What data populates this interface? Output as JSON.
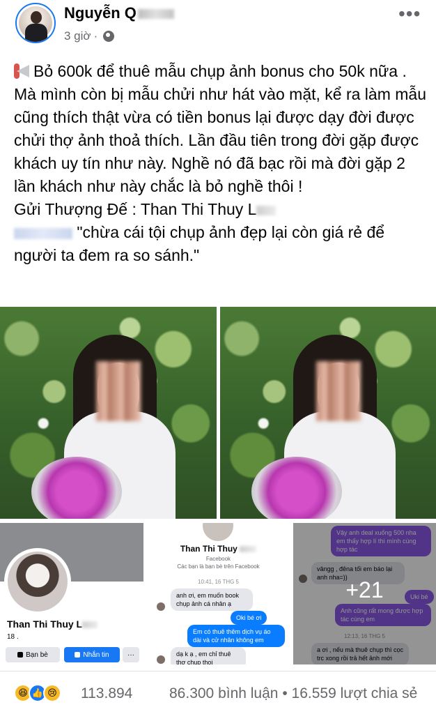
{
  "post": {
    "author_visible": "Nguyễn Q",
    "time": "3 giờ",
    "time_sep": "·",
    "more": "•••",
    "text_line1": "Bỏ 600k để thuê mẫu chụp ảnh bonus cho 50k nữa . Mà mình còn bị mẫu chửi như hát vào mặt, kể ra làm mẫu cũng thích thật vừa có tiền bonus lại được dạy đời được chửi thợ ảnh thoả thích. Lần đầu tiên trong đời gặp được khách uy tín như này. Nghề nó đã bạc rồi mà đời gặp 2 lần khách như này chắc là bỏ nghề thôi !",
    "text_line2_prefix": " Gửi Thượng Đế : Than Thi Thuy L",
    "text_line3_quote": " \"chừa cái tội chụp ảnh đẹp lại còn giá rẻ để người ta đem ra so sánh.\""
  },
  "collage": {
    "profile": {
      "name": "Than Thi Thuy L",
      "friends": "18 .",
      "btn_friend": "Bạn bè",
      "btn_message": "Nhắn tin",
      "btn_more": "···"
    },
    "chat1": {
      "name": "Than Thi Thuy",
      "platform": "Facebook",
      "subtitle": "Các bạn là bạn bè trên Facebook",
      "time": "10:41, 16 THG 5",
      "m1": "anh ơi, em muốn book chụp ảnh cá nhân ạ",
      "m2": "Oki bé ơi",
      "m3": "Em có thuê thêm dịch vụ áo dài và cử nhân không em",
      "m4": "dạ k ạ , em chỉ thuê thợ chụp thoi"
    },
    "chat2": {
      "m1": "Vậy anh deal xuống 500 nha em thấy hợp lí thì mình cùng hợp tác",
      "m2": "vângg , đêna tối em báo lại anh nha=))",
      "m3": "Uki bé",
      "m4": "Anh cũng rất mong được hợp tác cùng em",
      "time": "12:13, 16 THG 5",
      "m5": "a ơi , nếu mà thuê chụp thì cọc trc xong rồi trả hết ảnh mới",
      "more_count": "+21"
    }
  },
  "footer": {
    "reactions": [
      "haha-icon",
      "like-icon",
      "sad-icon"
    ],
    "reaction_count": "113.894",
    "comments": "86.300 bình luận",
    "sep": "•",
    "shares": "16.559 lượt chia sẻ"
  },
  "colors": {
    "fb_blue": "#1877f2",
    "text": "#050505",
    "muted": "#65676b"
  }
}
